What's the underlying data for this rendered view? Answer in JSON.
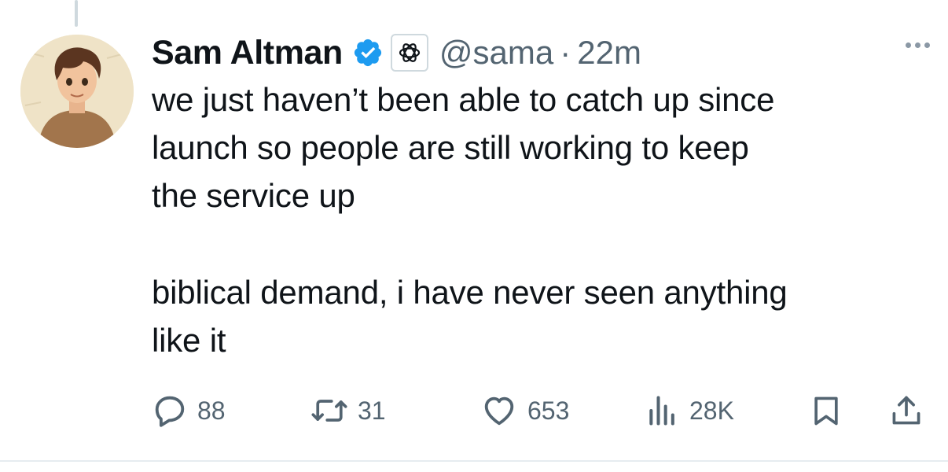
{
  "tweet": {
    "author_name": "Sam Altman",
    "handle": "@sama",
    "separator": "·",
    "time": "22m",
    "text_lines_p1": [
      "we just haven’t been able to catch up since",
      "launch so people are still working to keep",
      "the service up"
    ],
    "text_lines_p2": [
      "biblical demand, i have never seen anything",
      "like it"
    ]
  },
  "actions": {
    "replies": "88",
    "reposts": "31",
    "likes": "653",
    "views": "28K"
  },
  "icons": {
    "verified": "verified-badge-icon",
    "affiliation": "openai-logo-icon",
    "more": "more-icon",
    "reply": "reply-icon",
    "repost": "repost-icon",
    "like": "heart-icon",
    "views": "views-icon",
    "bookmark": "bookmark-icon",
    "share": "share-icon"
  },
  "colors": {
    "text": "#0f1419",
    "secondary": "#536471",
    "verified_blue": "#1d9bf0"
  }
}
